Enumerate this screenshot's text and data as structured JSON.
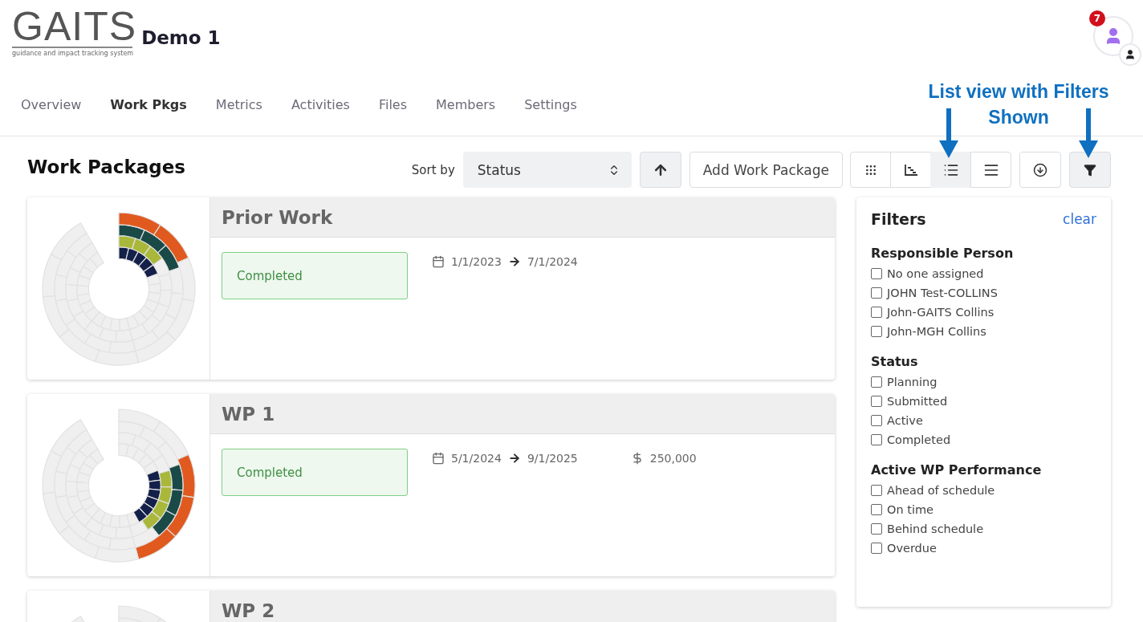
{
  "logo": {
    "wordmark": "GAITS",
    "tagline": "guidance and impact tracking system"
  },
  "project_title": "Demo 1",
  "notifications": {
    "count": "7"
  },
  "tabs": [
    {
      "label": "Overview",
      "selected": false
    },
    {
      "label": "Work Pkgs",
      "selected": true
    },
    {
      "label": "Metrics",
      "selected": false
    },
    {
      "label": "Activities",
      "selected": false
    },
    {
      "label": "Files",
      "selected": false
    },
    {
      "label": "Members",
      "selected": false
    },
    {
      "label": "Settings",
      "selected": false
    }
  ],
  "page_title": "Work Packages",
  "sort": {
    "label": "Sort by",
    "value": "Status"
  },
  "add_button": "Add Work Package",
  "view_buttons": [
    {
      "kind": "grid",
      "selected": false
    },
    {
      "kind": "timeline",
      "selected": false
    },
    {
      "kind": "list",
      "selected": true
    },
    {
      "kind": "compact",
      "selected": false
    }
  ],
  "filter_button": {
    "selected": true
  },
  "annotation": "List view with Filters Shown",
  "work_packages": [
    {
      "title": "Prior Work",
      "status": "Completed",
      "start": "1/1/2023",
      "end": "7/1/2024"
    },
    {
      "title": "WP 1",
      "status": "Completed",
      "start": "5/1/2024",
      "end": "9/1/2025",
      "budget": "250,000"
    },
    {
      "title": "WP 2"
    }
  ],
  "filters": {
    "title": "Filters",
    "clear": "clear",
    "groups": [
      {
        "title": "Responsible Person",
        "options": [
          {
            "label": "No one assigned",
            "checked": false
          },
          {
            "label": "JOHN Test-COLLINS",
            "checked": false
          },
          {
            "label": "John-GAITS Collins",
            "checked": false
          },
          {
            "label": "John-MGH Collins",
            "checked": false
          }
        ]
      },
      {
        "title": "Status",
        "options": [
          {
            "label": "Planning",
            "checked": false
          },
          {
            "label": "Submitted",
            "checked": false
          },
          {
            "label": "Active",
            "checked": false
          },
          {
            "label": "Completed",
            "checked": false
          }
        ]
      },
      {
        "title": "Active WP Performance",
        "options": [
          {
            "label": "Ahead of schedule",
            "checked": false
          },
          {
            "label": "On time",
            "checked": false
          },
          {
            "label": "Behind schedule",
            "checked": false
          },
          {
            "label": "Overdue",
            "checked": false
          }
        ]
      }
    ]
  }
}
